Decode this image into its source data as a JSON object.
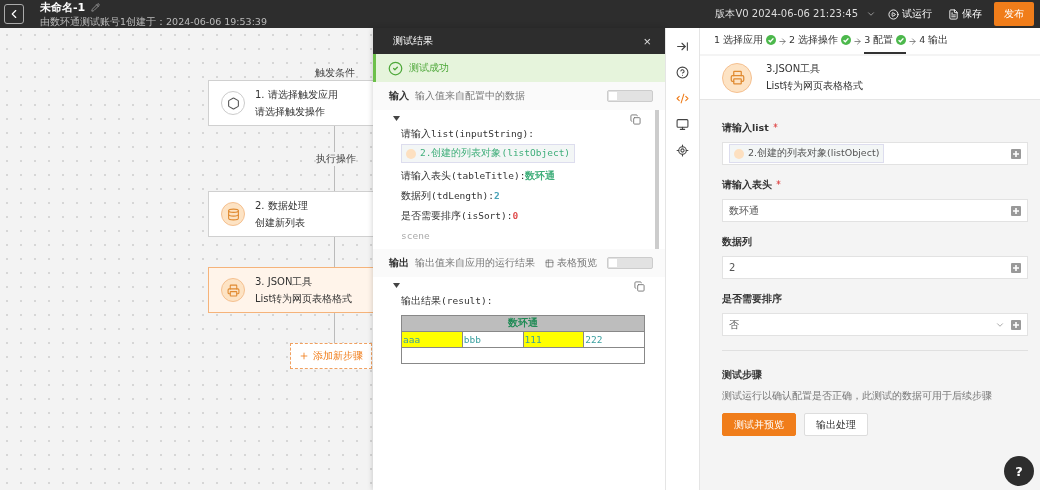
{
  "topbar": {
    "title": "未命名-1",
    "subtitle": "由数环通测试账号1创建于：2024-06-06 19:53:39",
    "version": "版本V0 2024-06-06 21:23:45",
    "actions": [
      {
        "kind": "run",
        "label": "试运行"
      },
      {
        "kind": "save",
        "label": "保存"
      },
      {
        "kind": "publish",
        "label": "发布"
      }
    ]
  },
  "canvas": {
    "trigger_label": "触发条件",
    "action_label": "执行操作",
    "nodes": [
      {
        "kind": "trigger",
        "title": "1. 请选择触发应用",
        "subtitle": "请选择触发操作",
        "selected": false
      },
      {
        "kind": "data",
        "title": "2. 数据处理",
        "subtitle": "创建新列表",
        "selected": false
      },
      {
        "kind": "json",
        "title": "3. JSON工具",
        "subtitle": "List转为网页表格格式",
        "selected": true
      }
    ],
    "add_step": "添加新步骤"
  },
  "test_panel": {
    "title": "测试结果",
    "close": "×",
    "status": "测试成功",
    "input": {
      "label": "输入",
      "hint": "输入值来自配置中的数据",
      "on": false
    },
    "input_lines": [
      {
        "kind": "chip",
        "label": "请输入list(inputString):",
        "value": "2.创建的列表对象(listObject)"
      },
      {
        "kind": "text",
        "label": "请输入表头(tableTitle):",
        "value": "数环通",
        "color": "#3fae7a"
      },
      {
        "kind": "text",
        "label": "数据列(tdLength):",
        "value": "2",
        "color": "#4aa3b8"
      },
      {
        "kind": "text",
        "label": "是否需要排序(isSort):",
        "value": "0",
        "color": "#e05050"
      },
      {
        "kind": "plain",
        "label": "scene"
      }
    ],
    "output": {
      "label": "输出",
      "hint": "输出值来自应用的运行结果",
      "preview": "表格预览",
      "on": false
    },
    "result_label": "输出结果(result):",
    "result_table": {
      "header": "数环通",
      "cells": [
        {
          "text": "aaa",
          "highlighted": true
        },
        {
          "text": "bbb",
          "highlighted": false
        },
        {
          "text": "111",
          "highlighted": true
        },
        {
          "text": "222",
          "highlighted": false
        }
      ]
    }
  },
  "side_icons": [
    {
      "kind": "collapse",
      "selected": false
    },
    {
      "kind": "help",
      "selected": false
    },
    {
      "kind": "code",
      "selected": true
    },
    {
      "kind": "console",
      "selected": false
    },
    {
      "kind": "location",
      "selected": false
    }
  ],
  "config": {
    "steps": [
      {
        "label": "1 选择应用",
        "done": true,
        "selected": false
      },
      {
        "label": "2 选择操作",
        "done": true,
        "selected": false
      },
      {
        "label": "3 配置",
        "done": true,
        "selected": true
      },
      {
        "label": "4 输出",
        "done": false,
        "selected": false
      }
    ],
    "node_title": "3.JSON工具",
    "node_subtitle": "List转为网页表格格式",
    "fields": [
      {
        "kind": "chip",
        "label": "请输入list",
        "required": true,
        "value": "2.创建的列表对象(listObject)"
      },
      {
        "kind": "text",
        "label": "请输入表头",
        "required": true,
        "value": "数环通"
      },
      {
        "kind": "text",
        "label": "数据列",
        "required": false,
        "value": "2"
      },
      {
        "kind": "select",
        "label": "是否需要排序",
        "required": false,
        "value": "否"
      }
    ],
    "test_title": "测试步骤",
    "test_desc": "测试运行以确认配置是否正确，此测试的数据可用于后续步骤",
    "buttons": [
      {
        "kind": "primary",
        "label": "测试并预览"
      },
      {
        "kind": "secondary",
        "label": "输出处理"
      }
    ],
    "help": "?"
  }
}
